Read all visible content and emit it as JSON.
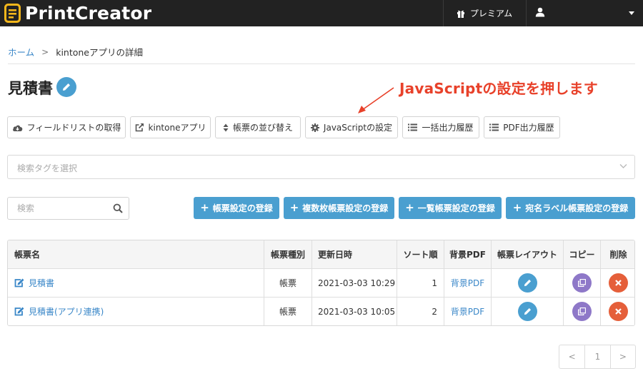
{
  "header": {
    "brand": "PrintCreator",
    "premium_label": "プレミアム"
  },
  "breadcrumb": {
    "home": "ホーム",
    "separator": ">",
    "current": "kintoneアプリの詳細"
  },
  "page": {
    "title": "見積書"
  },
  "annotation": {
    "text": "JavaScriptの設定を押します",
    "color": "#e8412a"
  },
  "toolbar": {
    "field_list": "フィールドリストの取得",
    "kintone_app": "kintoneアプリ",
    "sort_forms": "帳票の並び替え",
    "js_settings": "JavaScriptの設定",
    "bulk_history": "一括出力履歴",
    "pdf_history": "PDF出力履歴"
  },
  "tag_select": {
    "placeholder": "検索タグを選択"
  },
  "search": {
    "placeholder": "検索"
  },
  "actions": {
    "register_form": "帳票設定の登録",
    "register_multi": "複数枚帳票設定の登録",
    "register_list": "一覧帳票設定の登録",
    "register_label": "宛名ラベル帳票設定の登録"
  },
  "table": {
    "headers": {
      "name": "帳票名",
      "type": "帳票種別",
      "updated": "更新日時",
      "sort": "ソート順",
      "bg_pdf": "背景PDF",
      "layout": "帳票レイアウト",
      "copy": "コピー",
      "delete": "削除"
    },
    "rows": [
      {
        "name": "見積書",
        "type": "帳票",
        "updated": "2021-03-03 10:29",
        "sort": "1",
        "bg_pdf": "背景PDF"
      },
      {
        "name": "見積書(アプリ連携)",
        "type": "帳票",
        "updated": "2021-03-03 10:05",
        "sort": "2",
        "bg_pdf": "背景PDF"
      }
    ]
  },
  "pagination": {
    "prev": "<",
    "current": "1",
    "next": ">"
  },
  "colors": {
    "primary": "#4a9fd0",
    "copy": "#8e78c8",
    "delete": "#e55f3a",
    "navbar": "#222222",
    "link": "#3a87c8"
  }
}
